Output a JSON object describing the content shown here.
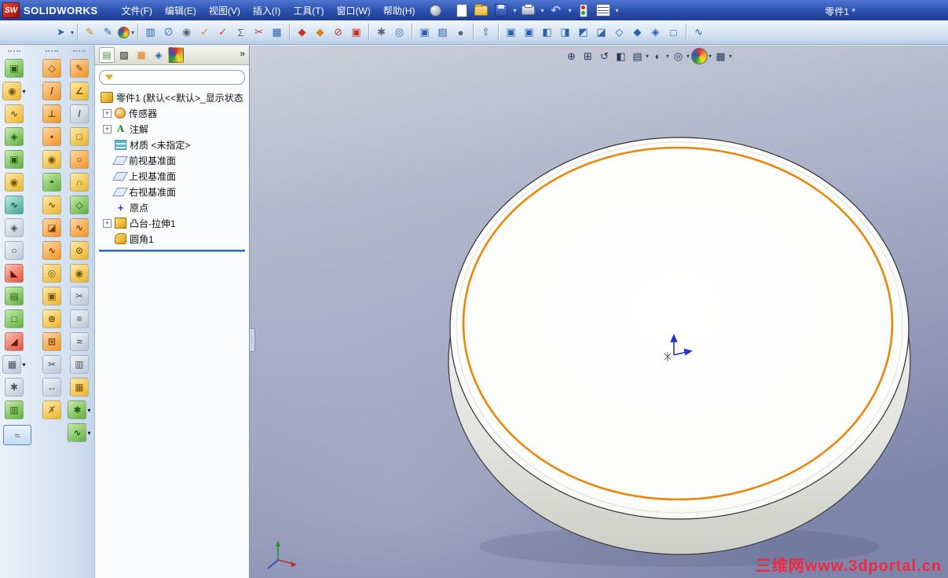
{
  "titlebar": {
    "app_name": "SOLIDWORKS",
    "logo_text": "SW",
    "menus": [
      "文件(F)",
      "编辑(E)",
      "视图(V)",
      "插入(I)",
      "工具(T)",
      "窗口(W)",
      "帮助(H)"
    ],
    "document_title": "零件1 *",
    "quick_icons": [
      "new-document-icon",
      "open-document-icon",
      "save-icon",
      "print-icon",
      "undo-icon",
      "rebuild-icon",
      "options-icon"
    ]
  },
  "main_toolbar": [
    {
      "name": "select-tool-icon",
      "glyph": "➤",
      "color": "blue",
      "dropdown": true
    },
    {
      "sep": true
    },
    {
      "name": "sketch-icon",
      "glyph": "✎",
      "color": "orange"
    },
    {
      "name": "3d-sketch-icon",
      "glyph": "✎",
      "color": "blue"
    },
    {
      "name": "appearance-color-icon",
      "glyph": "●",
      "color": "multi",
      "dropdown": true
    },
    {
      "sep": true
    },
    {
      "name": "selection-filter-icon",
      "glyph": "▥",
      "color": "blue"
    },
    {
      "name": "measure-icon",
      "glyph": "∅",
      "color": "blue"
    },
    {
      "name": "mass-properties-icon",
      "glyph": "◉",
      "color": "gray"
    },
    {
      "name": "check-sketch-icon",
      "glyph": "✓",
      "color": "orange"
    },
    {
      "name": "spell-check-icon",
      "glyph": "✓",
      "color": "red"
    },
    {
      "name": "equations-icon",
      "glyph": "Σ",
      "color": "gray"
    },
    {
      "name": "trim-icon",
      "glyph": "✂",
      "color": "red"
    },
    {
      "name": "design-table-icon",
      "glyph": "▦",
      "color": "blue"
    },
    {
      "sep": true
    },
    {
      "name": "edit-feature-icon",
      "glyph": "◆",
      "color": "red"
    },
    {
      "name": "instant3d-icon",
      "glyph": "◆",
      "color": "orange"
    },
    {
      "name": "suppress-icon",
      "glyph": "⊘",
      "color": "red"
    },
    {
      "name": "block-icon",
      "glyph": "▣",
      "color": "red"
    },
    {
      "sep": true
    },
    {
      "name": "toolbox-icon",
      "glyph": "✱",
      "color": "gray"
    },
    {
      "name": "render-icon",
      "glyph": "◎",
      "color": "blue"
    },
    {
      "sep": true
    },
    {
      "name": "texture-icon",
      "glyph": "▣",
      "color": "blue"
    },
    {
      "name": "material-editor-icon",
      "glyph": "▤",
      "color": "blue"
    },
    {
      "name": "sphere-icon",
      "glyph": "●",
      "color": "gray"
    },
    {
      "sep": true
    },
    {
      "name": "exploded-view-icon",
      "glyph": "⇧",
      "color": "blue"
    },
    {
      "sep": true
    },
    {
      "name": "view-front-icon",
      "glyph": "▣",
      "color": "blue"
    },
    {
      "name": "view-back-icon",
      "glyph": "▣",
      "color": "blue"
    },
    {
      "name": "view-left-icon",
      "glyph": "◧",
      "color": "blue"
    },
    {
      "name": "view-right-icon",
      "glyph": "◨",
      "color": "blue"
    },
    {
      "name": "view-top-icon",
      "glyph": "◩",
      "color": "blue"
    },
    {
      "name": "view-bottom-icon",
      "glyph": "◪",
      "color": "blue"
    },
    {
      "name": "view-isometric-icon",
      "glyph": "◇",
      "color": "blue"
    },
    {
      "name": "view-dimetric-icon",
      "glyph": "◆",
      "color": "blue"
    },
    {
      "name": "view-trimetric-icon",
      "glyph": "◈",
      "color": "blue"
    },
    {
      "name": "view-normal-icon",
      "glyph": "□",
      "color": "blue"
    },
    {
      "sep": true
    },
    {
      "name": "curve-icon",
      "glyph": "∿",
      "color": "blue"
    }
  ],
  "left_toolbars": {
    "column1": [
      {
        "name": "extruded-boss-icon",
        "glyph": "▣",
        "color": "green"
      },
      {
        "name": "revolved-boss-icon",
        "glyph": "◉",
        "color": "yellow",
        "dropdown": true
      },
      {
        "name": "swept-boss-icon",
        "glyph": "∿",
        "color": "yellow"
      },
      {
        "name": "lofted-boss-icon",
        "glyph": "◈",
        "color": "green"
      },
      {
        "name": "extruded-cut-icon",
        "glyph": "▣",
        "color": "green"
      },
      {
        "name": "revolved-cut-icon",
        "glyph": "◉",
        "color": "yellow"
      },
      {
        "name": "swept-cut-icon",
        "glyph": "∿",
        "color": "teal"
      },
      {
        "name": "lofted-cut-icon",
        "glyph": "◈",
        "color": "gray"
      },
      {
        "name": "fillet-icon",
        "glyph": "○",
        "color": "gray"
      },
      {
        "name": "chamfer-icon",
        "glyph": "◣",
        "color": "red"
      },
      {
        "name": "rib-icon",
        "glyph": "▤",
        "color": "green"
      },
      {
        "name": "shell-icon",
        "glyph": "□",
        "color": "green"
      },
      {
        "name": "draft-icon",
        "glyph": "◢",
        "color": "red"
      },
      {
        "name": "linear-pattern-icon",
        "glyph": "▦",
        "color": "gray",
        "dropdown": true
      },
      {
        "name": "circular-pattern-icon",
        "glyph": "✱",
        "color": "gray"
      },
      {
        "name": "mirror-icon",
        "glyph": "▥",
        "color": "green"
      }
    ],
    "column2": [
      {
        "name": "reference-plane-icon",
        "glyph": "◇",
        "color": "orange"
      },
      {
        "name": "reference-axis-icon",
        "glyph": "/",
        "color": "orange"
      },
      {
        "name": "coordinate-system-icon",
        "glyph": "⊥",
        "color": "orange"
      },
      {
        "name": "point-icon",
        "glyph": "•",
        "color": "orange"
      },
      {
        "name": "hole-wizard-icon",
        "glyph": "◉",
        "color": "yellow"
      },
      {
        "name": "dome-icon",
        "glyph": "◓",
        "color": "green"
      },
      {
        "name": "deform-icon",
        "glyph": "∿",
        "color": "yellow"
      },
      {
        "name": "indent-icon",
        "glyph": "◪",
        "color": "orange"
      },
      {
        "name": "flex-icon",
        "glyph": "∿",
        "color": "orange"
      },
      {
        "name": "wrap-icon",
        "glyph": "◎",
        "color": "yellow"
      },
      {
        "name": "cavity-icon",
        "glyph": "▣",
        "color": "yellow"
      },
      {
        "name": "join-icon",
        "glyph": "⊕",
        "color": "yellow"
      },
      {
        "name": "combine-icon",
        "glyph": "⊞",
        "color": "orange"
      },
      {
        "name": "split-icon",
        "glyph": "✂",
        "color": "gray"
      },
      {
        "name": "move-copy-icon",
        "glyph": "↔",
        "color": "gray"
      },
      {
        "name": "delete-body-icon",
        "glyph": "✗",
        "color": "yellow"
      }
    ],
    "column3": [
      {
        "name": "sketch-tool-icon",
        "glyph": "✎",
        "color": "orange"
      },
      {
        "name": "smart-dimension-icon",
        "glyph": "∠",
        "color": "yellow"
      },
      {
        "name": "line-icon",
        "glyph": "/",
        "color": "gray"
      },
      {
        "name": "rectangle-icon",
        "glyph": "□",
        "color": "yellow"
      },
      {
        "name": "circle-icon",
        "glyph": "○",
        "color": "orange"
      },
      {
        "name": "arc-icon",
        "glyph": "∩",
        "color": "yellow"
      },
      {
        "name": "polygon-icon",
        "glyph": "◇",
        "color": "green"
      },
      {
        "name": "spline-icon",
        "glyph": "∿",
        "color": "orange"
      },
      {
        "name": "ellipse-icon",
        "glyph": "⊙",
        "color": "yellow"
      },
      {
        "name": "sketch-fillet-icon",
        "glyph": "◉",
        "color": "yellow"
      },
      {
        "name": "trim-entities-icon",
        "glyph": "✂",
        "color": "gray"
      },
      {
        "name": "convert-entities-icon",
        "glyph": "≡",
        "color": "gray"
      },
      {
        "name": "offset-entities-icon",
        "glyph": "≈",
        "color": "gray"
      },
      {
        "name": "mirror-entities-icon",
        "glyph": "▥",
        "color": "gray"
      },
      {
        "name": "sketch-pattern-icon",
        "glyph": "▦",
        "color": "yellow"
      },
      {
        "name": "sketch-text-icon",
        "glyph": "✱",
        "color": "green",
        "dropdown": true
      },
      {
        "name": "3d-curve-icon",
        "glyph": "∿",
        "color": "green",
        "dropdown": true
      }
    ]
  },
  "dock_pressed_button": {
    "name": "floating-toolbar-handle"
  },
  "panel": {
    "tabs": [
      {
        "name": "tab-featuremanager",
        "glyph": "▤",
        "color": "green",
        "active": true
      },
      {
        "name": "tab-propertymanager",
        "glyph": "▨",
        "color": "teal"
      },
      {
        "name": "tab-configurationmanager",
        "glyph": "▦",
        "color": "orange"
      },
      {
        "name": "tab-dimxpertmanager",
        "glyph": "◈",
        "color": "blue"
      },
      {
        "name": "tab-displaymanager",
        "glyph": "●",
        "color": "multi"
      }
    ],
    "overflow_label": "»",
    "filter": {
      "value": "",
      "placeholder": ""
    },
    "tree": {
      "root": {
        "label": "零件1 (默认<<默认>_显示状态",
        "icon": "part"
      },
      "items": [
        {
          "label": "传感器",
          "icon": "sensors",
          "expandable": true
        },
        {
          "label": "注解",
          "icon": "annotations",
          "glyph": "A",
          "expandable": true
        },
        {
          "label": "材质 <未指定>",
          "icon": "material"
        },
        {
          "label": "前视基准面",
          "icon": "plane"
        },
        {
          "label": "上视基准面",
          "icon": "plane"
        },
        {
          "label": "右视基准面",
          "icon": "plane"
        },
        {
          "label": "原点",
          "icon": "origin",
          "glyph": "+"
        },
        {
          "label": "凸台-拉伸1",
          "icon": "boss-extrude",
          "expandable": true
        },
        {
          "label": "圆角1",
          "icon": "fillet"
        }
      ]
    }
  },
  "headsup": [
    {
      "name": "zoom-fit-icon",
      "glyph": "⊕"
    },
    {
      "name": "zoom-area-icon",
      "glyph": "⊞"
    },
    {
      "name": "previous-view-icon",
      "glyph": "↺"
    },
    {
      "name": "section-view-icon",
      "glyph": "◧"
    },
    {
      "name": "view-orientation-icon",
      "glyph": "▤",
      "dropdown": true
    },
    {
      "name": "display-style-icon",
      "glyph": "◐",
      "dropdown": true
    },
    {
      "name": "hide-show-items-icon",
      "glyph": "◎",
      "dropdown": true
    },
    {
      "name": "edit-appearance-icon",
      "glyph": "●",
      "color": "multi",
      "dropdown": true
    },
    {
      "name": "apply-scene-icon",
      "glyph": "▦",
      "dropdown": true
    }
  ],
  "viewport": {
    "watermark": "三维网www.3dportal.cn"
  },
  "colors": {
    "accent_orange": "#e8870c",
    "titlebar_blue": "#2b50ae",
    "rollback_blue": "#2a62c8",
    "watermark_red": "#f02840"
  }
}
